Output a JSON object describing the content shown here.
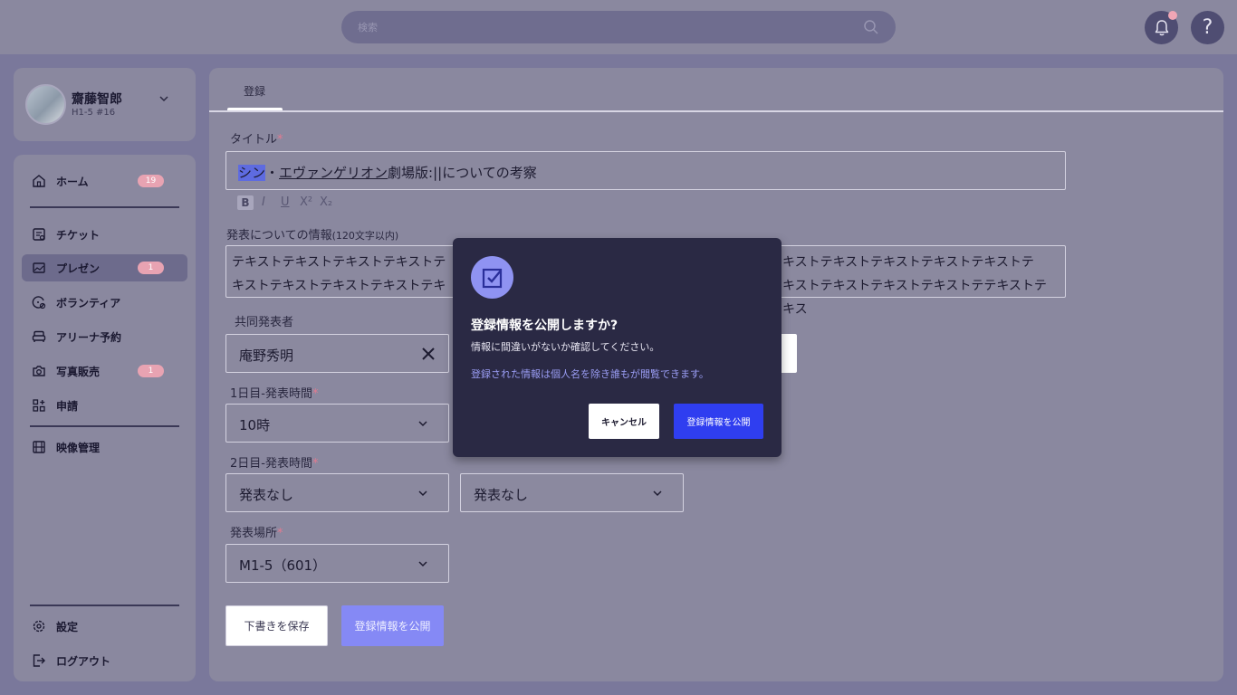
{
  "header": {
    "search_placeholder": "検索",
    "search_icon": "search-icon",
    "bell_icon": "bell-icon",
    "help_label": "?"
  },
  "profile": {
    "name": "齋藤智郎",
    "id": "H1-5 #16"
  },
  "sidebar": {
    "items": [
      {
        "label": "ホーム",
        "icon": "home-icon",
        "badge": "19"
      },
      {
        "label": "チケット",
        "icon": "ticket-icon",
        "badge": ""
      },
      {
        "label": "プレゼン",
        "icon": "presentation-icon",
        "badge": "1",
        "active": true
      },
      {
        "label": "ボランティア",
        "icon": "volunteer-icon",
        "badge": ""
      },
      {
        "label": "アリーナ予約",
        "icon": "sofa-icon",
        "badge": ""
      },
      {
        "label": "写真販売",
        "icon": "camera-icon",
        "badge": "1"
      },
      {
        "label": "申請",
        "icon": "apply-icon",
        "badge": ""
      },
      {
        "label": "映像管理",
        "icon": "film-icon",
        "badge": ""
      }
    ],
    "footer": [
      {
        "label": "設定",
        "icon": "gear-icon"
      },
      {
        "label": "ログアウト",
        "icon": "logout-icon"
      }
    ]
  },
  "main": {
    "tab": "登録",
    "title_label": "タイトル",
    "title_value": {
      "part1": "シン",
      "part2": "・",
      "part3": "エヴァンゲリオン",
      "part4": "劇場版:||についての考察"
    },
    "format_buttons": [
      "B",
      "I",
      "U",
      "X²",
      "X₂"
    ],
    "info_label": "発表についての情報",
    "info_hint": "(120文字以内)",
    "info_line1": "テキストテキストテキストテキストテ",
    "info_line1_end": "キストテキストテキストテキストテキストテ",
    "info_line2": "キストテキストテキストテキストテキ",
    "info_line2_end": "キストテキストテキストテキストテテキストテキス",
    "co_label": "共同発表者",
    "co_value": "庵野秀明",
    "day1_label": "1日目-発表時間",
    "day1_value": "10時",
    "day2_label": "2日目-発表時間",
    "day2_value_a": "発表なし",
    "day2_value_b": "発表なし",
    "place_label": "発表場所",
    "place_value": "M1-5（601）",
    "required_mark": "*",
    "draft_button": "下書きを保存",
    "publish_button": "登録情報を公開"
  },
  "modal": {
    "title": "登録情報を公開しますか?",
    "subtitle": "情報に間違いがないか確認してください。",
    "note": "登録された情報は個人名を除き誰もが閲覧できます。",
    "cancel": "キャンセル",
    "confirm": "登録情報を公開",
    "icon": "checkbox-icon"
  },
  "colors": {
    "accent": "#2f3ef0",
    "badge": "#e8a3b2",
    "required": "#e27a90",
    "modal_bg": "#2a2944"
  }
}
